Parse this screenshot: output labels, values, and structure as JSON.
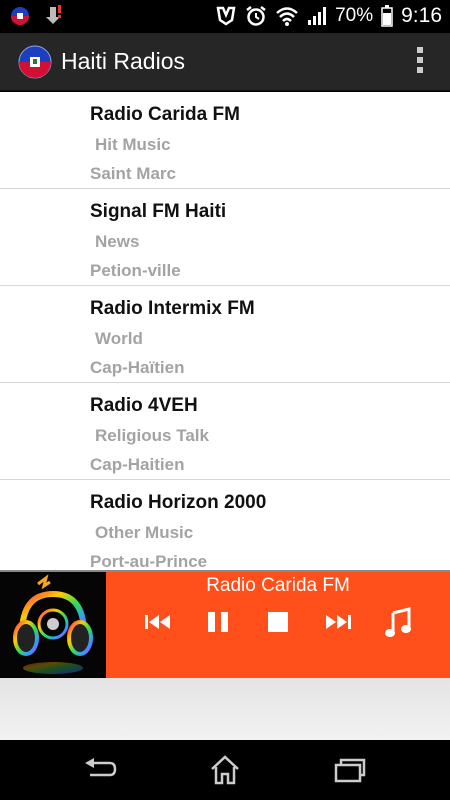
{
  "status_bar": {
    "battery": "70%",
    "time": "9:16"
  },
  "app": {
    "title": "Haiti Radios"
  },
  "stations": [
    {
      "name": "Radio Carida FM",
      "genre": "Hit Music",
      "city": "Saint Marc"
    },
    {
      "name": "Signal FM Haiti",
      "genre": "News",
      "city": "Petion-ville"
    },
    {
      "name": "Radio Intermix FM",
      "genre": "World",
      "city": "Cap-Haïtien"
    },
    {
      "name": "Radio 4VEH",
      "genre": "Religious Talk",
      "city": "Cap-Haitien"
    },
    {
      "name": "Radio Horizon 2000",
      "genre": "Other Music",
      "city": "Port-au-Prince"
    }
  ],
  "player": {
    "now_playing": "Radio Carida FM",
    "controls": [
      "previous-icon",
      "pause-icon",
      "stop-icon",
      "next-icon",
      "music-note-icon"
    ]
  },
  "colors": {
    "player_bg": "#ff4f1a",
    "action_bar": "#262626",
    "secondary_text": "#a3a3a3"
  }
}
